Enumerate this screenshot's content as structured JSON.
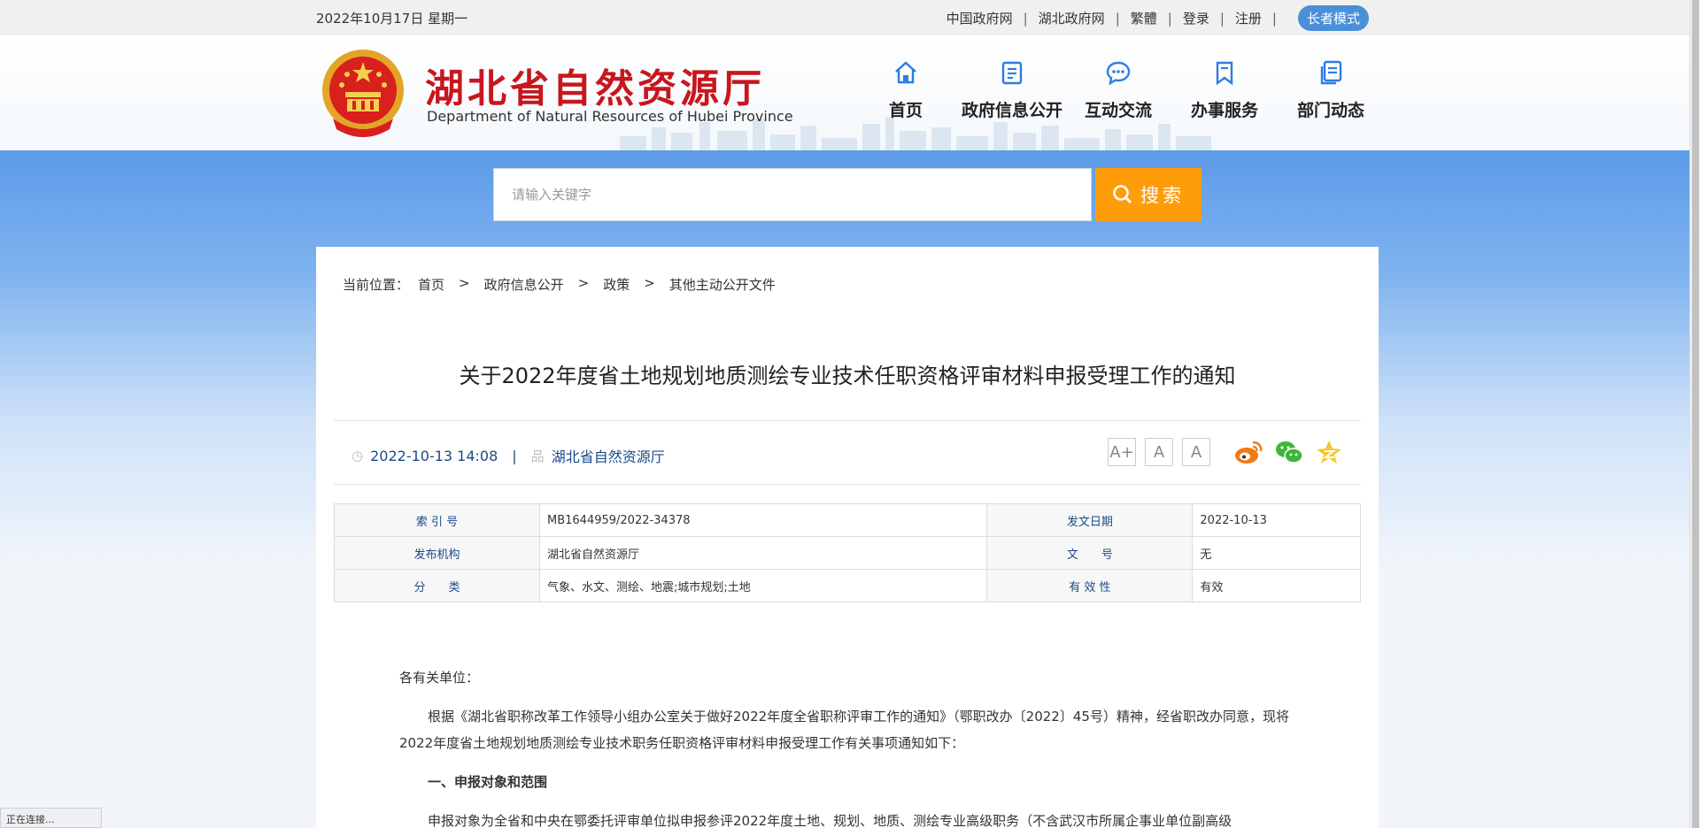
{
  "topbar": {
    "date": "2022年10月17日 星期一",
    "links": [
      "中国政府网",
      "湖北政府网",
      "繁體",
      "登录",
      "注册"
    ],
    "elder_mode": "长者模式"
  },
  "header": {
    "title": "湖北省自然资源厅",
    "subtitle": "Department of Natural Resources of Hubei Province",
    "nav": [
      {
        "label": "首页",
        "icon": "home-icon"
      },
      {
        "label": "政府信息公开",
        "icon": "document-icon"
      },
      {
        "label": "互动交流",
        "icon": "chat-icon"
      },
      {
        "label": "办事服务",
        "icon": "bookmark-icon"
      },
      {
        "label": "部门动态",
        "icon": "news-icon"
      }
    ]
  },
  "search": {
    "placeholder": "请输入关键字",
    "button": "搜索"
  },
  "breadcrumb": {
    "prefix": "当前位置：",
    "items": [
      "首页",
      "政府信息公开",
      "政策",
      "其他主动公开文件"
    ]
  },
  "article": {
    "title": "关于2022年度省土地规划地质测绘专业技术任职资格评审材料申报受理工作的通知",
    "datetime": "2022-10-13 14:08",
    "source": "湖北省自然资源厅",
    "font_sizes": [
      "A+",
      "A",
      "A"
    ],
    "info": [
      {
        "k1": "索 引 号",
        "v1": "MB1644959/2022-34378",
        "k2": "发文日期",
        "v2": "2022-10-13"
      },
      {
        "k1": "发布机构",
        "v1": "湖北省自然资源厅",
        "k2": "文　　号",
        "v2": "无"
      },
      {
        "k1": "分　　类",
        "v1": "气象、水文、测绘、地震;城市规划;土地",
        "k2": "有 效 性",
        "v2": "有效"
      }
    ],
    "salutation": "各有关单位：",
    "para1": "根据《湖北省职称改革工作领导小组办公室关于做好2022年度全省职称评审工作的通知》（鄂职改办〔2022〕45号）精神，经省职改办同意，现将2022年度省土地规划地质测绘专业技术职务任职资格评审材料申报受理工作有关事项通知如下：",
    "heading1": "一、申报对象和范围",
    "para2": "申报对象为全省和中央在鄂委托评审单位拟申报参评2022年度土地、规划、地质、测绘专业高级职务（不含武汉市所属企事业单位副高级"
  },
  "status": "正在连接..."
}
